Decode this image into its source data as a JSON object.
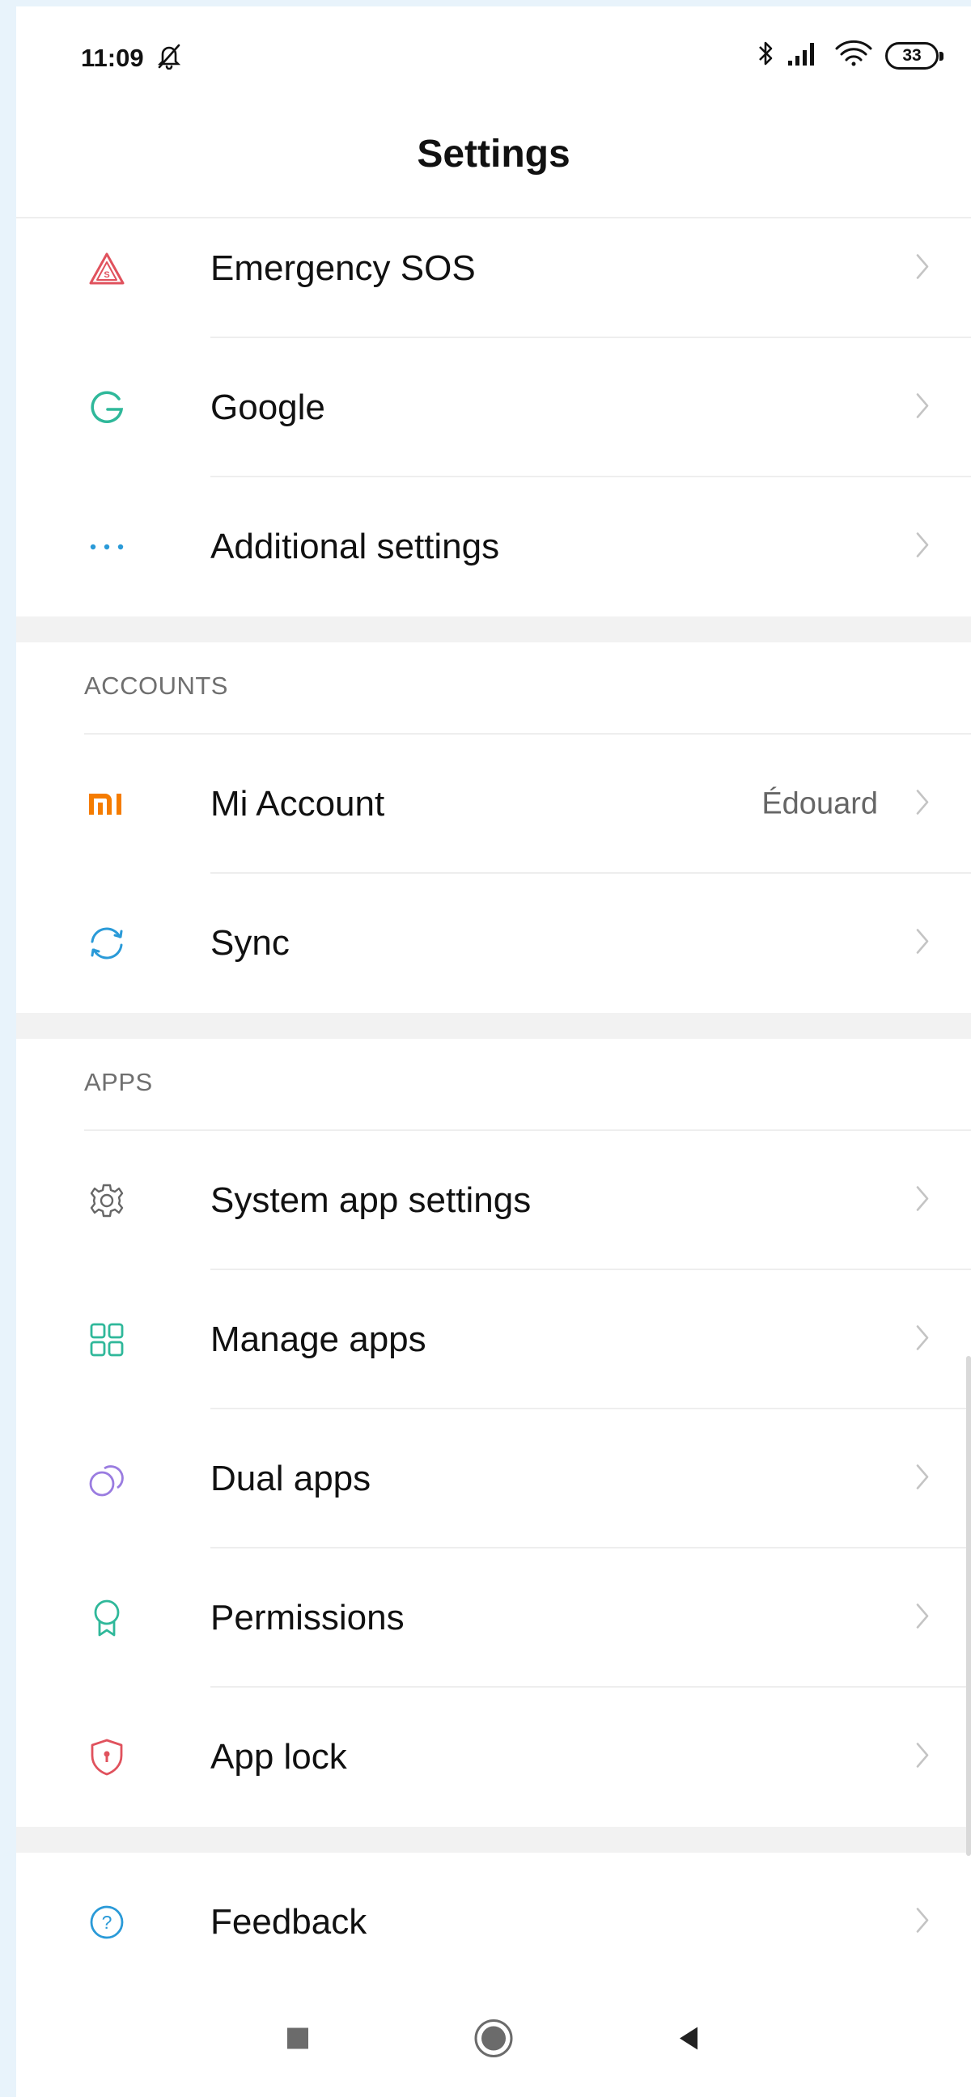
{
  "status_bar": {
    "time": "11:09",
    "battery": "33",
    "icons": [
      "do-not-disturb-icon",
      "bluetooth-icon",
      "signal-icon",
      "wifi-icon",
      "battery-icon"
    ]
  },
  "header": {
    "title": "Settings"
  },
  "items_top": [
    {
      "label": "Emergency SOS",
      "icon": "emergency-sos-icon"
    },
    {
      "label": "Google",
      "icon": "google-icon"
    },
    {
      "label": "Additional settings",
      "icon": "more-icon"
    }
  ],
  "accounts": {
    "header": "ACCOUNTS",
    "items": [
      {
        "label": "Mi Account",
        "value": "Édouard",
        "icon": "mi-logo-icon"
      },
      {
        "label": "Sync",
        "icon": "sync-icon"
      }
    ]
  },
  "apps": {
    "header": "APPS",
    "items": [
      {
        "label": "System app settings",
        "icon": "gear-icon"
      },
      {
        "label": "Manage apps",
        "icon": "grid-icon"
      },
      {
        "label": "Dual apps",
        "icon": "dual-apps-icon"
      },
      {
        "label": "Permissions",
        "icon": "permissions-icon"
      },
      {
        "label": "App lock",
        "icon": "shield-icon"
      }
    ]
  },
  "feedback": {
    "label": "Feedback",
    "icon": "help-icon"
  },
  "nav_bar": {
    "buttons": [
      "recents-button",
      "home-button",
      "back-button"
    ]
  },
  "colors": {
    "sos": "#e0525d",
    "google": "#2fb89a",
    "more": "#2a9ad8",
    "mi": "#f57c00",
    "sync": "#2a9ad8",
    "gear": "#666666",
    "grid": "#2fb89a",
    "dual": "#9a7ce0",
    "permissions": "#2fb89a",
    "lock": "#e0525d",
    "help": "#2a9ad8"
  }
}
